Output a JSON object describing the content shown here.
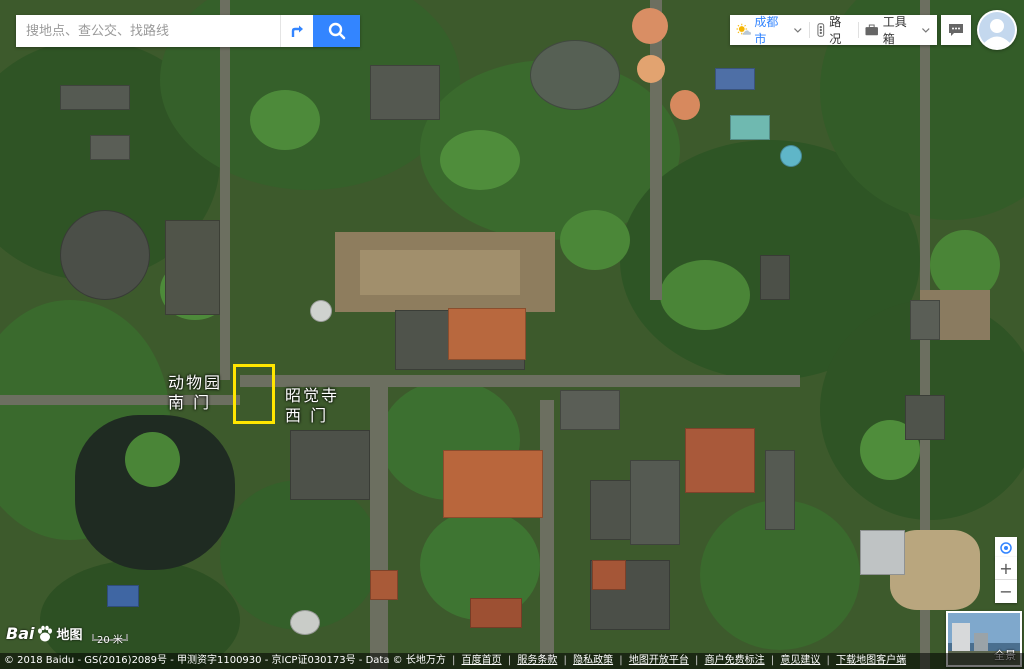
{
  "search": {
    "placeholder": "搜地点、查公交、找路线"
  },
  "toolbar": {
    "city": "成都市",
    "traffic": "路况",
    "toolbox": "工具箱"
  },
  "labels": {
    "zoo_south_gate": "动物园\n南 门",
    "zhaojue_west_gate": "昭觉寺\n西 门"
  },
  "map_controls": {
    "zoom_in": "+",
    "zoom_out": "−",
    "pano_label": "全景"
  },
  "logo": {
    "text": "地图",
    "brand": "Bai"
  },
  "scale": {
    "label": "20 米"
  },
  "footer": {
    "copyright": "© 2018 Baidu - GS(2016)2089号 - 甲测资字1100930 - 京ICP证030173号 - Data © 长地万方",
    "links": [
      "百度首页",
      "服务条款",
      "隐私政策",
      "地图开放平台",
      "商户免费标注",
      "意见建议",
      "下载地图客户端"
    ]
  },
  "colors": {
    "accent": "#3385ff",
    "marker": "#ffe600"
  }
}
